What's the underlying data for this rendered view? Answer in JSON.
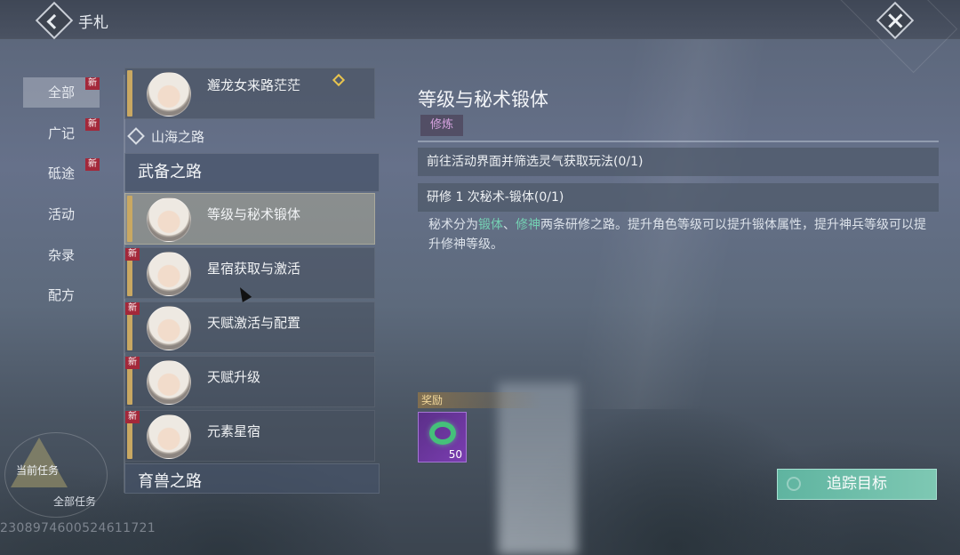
{
  "header": {
    "title": "手札"
  },
  "categories": [
    {
      "label": "全部",
      "new": "新"
    },
    {
      "label": "广记",
      "new": "新"
    },
    {
      "label": "砥途",
      "new": "新"
    },
    {
      "label": "活动",
      "new": ""
    },
    {
      "label": "杂录",
      "new": ""
    },
    {
      "label": "配方",
      "new": ""
    }
  ],
  "quest_list": {
    "top_quest": "邂龙女来路茫茫",
    "section_link": "山海之路",
    "section_header": "武备之路",
    "quests": [
      {
        "name": "等级与秘术锻体",
        "new": ""
      },
      {
        "name": "星宿获取与激活",
        "new": "新"
      },
      {
        "name": "天赋激活与配置",
        "new": "新"
      },
      {
        "name": "天赋升级",
        "new": "新"
      },
      {
        "name": "元素星宿",
        "new": "新"
      }
    ],
    "next_section": "育兽之路"
  },
  "detail": {
    "title": "等级与秘术锻体",
    "tag": "修炼",
    "objectives": [
      "前往活动界面并筛选灵气获取玩法(0/1)",
      "研修 1 次秘术-锻体(0/1)"
    ],
    "desc_pre": "秘术分为",
    "desc_hl1": "锻体",
    "desc_sep": "、",
    "desc_hl2": "修神",
    "desc_post": "两条研修之路。提升角色等级可以提升锻体属性，提升神兵等级可以提升修神等级。",
    "highlight_color": "#74d0b3",
    "reward_label": "奖励",
    "reward_count": "50",
    "track_button": "追踪目标"
  },
  "task_widget": {
    "current": "当前任务",
    "all": "全部任务"
  },
  "uid": "2308974600524611721"
}
